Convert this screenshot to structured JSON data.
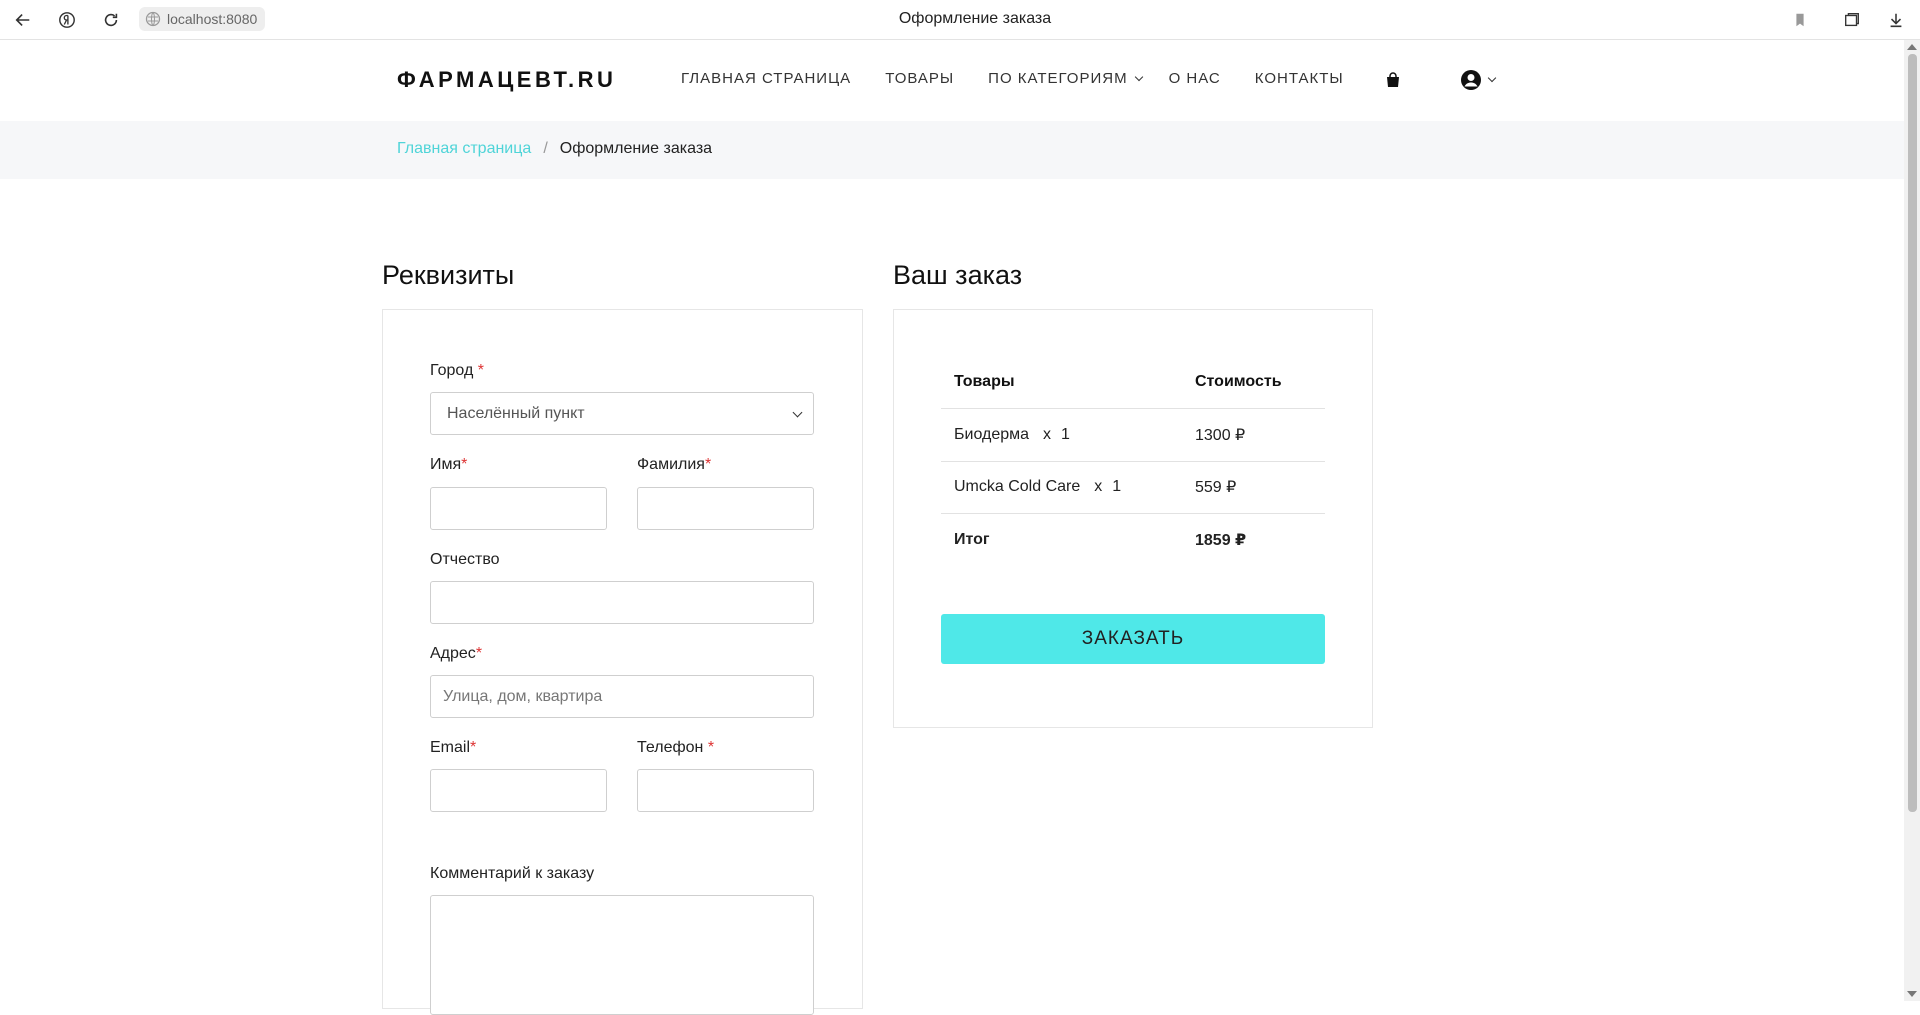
{
  "browser": {
    "url": "localhost:8080",
    "tab_title": "Оформление заказа"
  },
  "header": {
    "logo": "ФАРМАЦЕВТ.RU",
    "nav": {
      "home": "ГЛАВНАЯ СТРАНИЦА",
      "products": "ТОВАРЫ",
      "categories": "ПО КАТЕГОРИЯМ",
      "about": "О НАС",
      "contacts": "КОНТАКТЫ"
    }
  },
  "breadcrumb": {
    "home": "Главная страница",
    "separator": "/",
    "current": "Оформление заказа"
  },
  "details": {
    "title": "Реквизиты",
    "city_label": "Город",
    "city_selected": "Населённый пункт",
    "first_name_label": "Имя",
    "last_name_label": "Фамилия",
    "patronymic_label": "Отчество",
    "address_label": "Адрес",
    "address_placeholder": "Улица, дом, квартира",
    "email_label": "Email",
    "phone_label": "Телефон",
    "comment_label": "Комментарий к заказу",
    "required_mark": "*"
  },
  "order": {
    "title": "Ваш заказ",
    "col_products": "Товары",
    "col_cost": "Стоимость",
    "items": [
      {
        "name": "Биодерма",
        "x": "x",
        "qty": "1",
        "price": "1300 ₽"
      },
      {
        "name": "Umcka Cold Care",
        "x": "x",
        "qty": "1",
        "price": "559 ₽"
      }
    ],
    "total_label": "Итог",
    "total_value": "1859 ₽",
    "submit_label": "ЗАКАЗАТЬ"
  },
  "colors": {
    "accent": "#4fe8e8",
    "link": "#4fd4d8",
    "required": "#dd3333"
  }
}
